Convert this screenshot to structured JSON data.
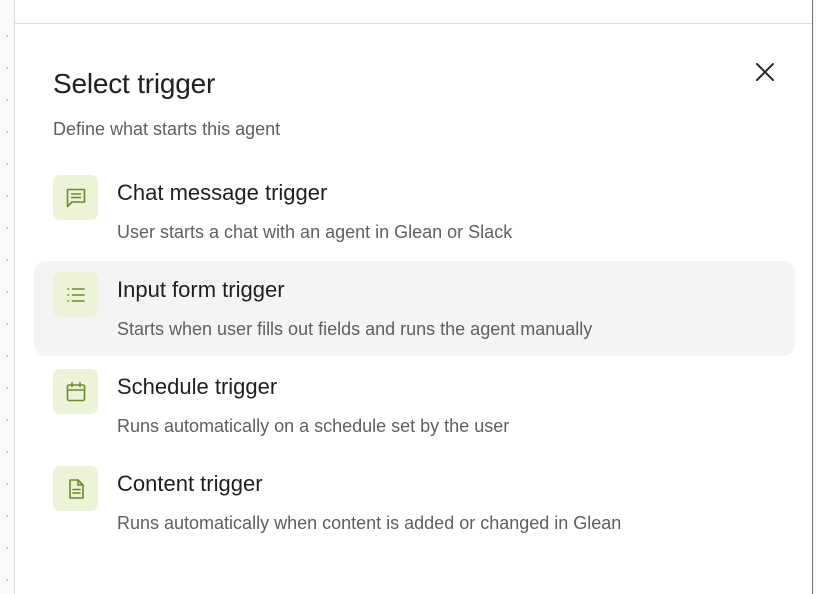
{
  "dialog": {
    "title": "Select trigger",
    "subtitle": "Define what starts this agent",
    "close_icon": "close-icon"
  },
  "triggers": [
    {
      "name": "Chat message trigger",
      "description": "User starts a chat with an agent in Glean or Slack",
      "icon": "chat-message-icon",
      "highlighted": false
    },
    {
      "name": "Input form trigger",
      "description": "Starts when user fills out fields and runs the agent manually",
      "icon": "list-icon",
      "highlighted": true
    },
    {
      "name": "Schedule trigger",
      "description": "Runs automatically on a schedule set by the user",
      "icon": "calendar-icon",
      "highlighted": false
    },
    {
      "name": "Content trigger",
      "description": "Runs automatically when content is added or changed in Glean",
      "icon": "document-icon",
      "highlighted": false
    }
  ],
  "colors": {
    "icon_bg": "#ecf3d6",
    "icon_stroke": "#6b8a2a",
    "hover_bg": "#f4f4f4"
  }
}
